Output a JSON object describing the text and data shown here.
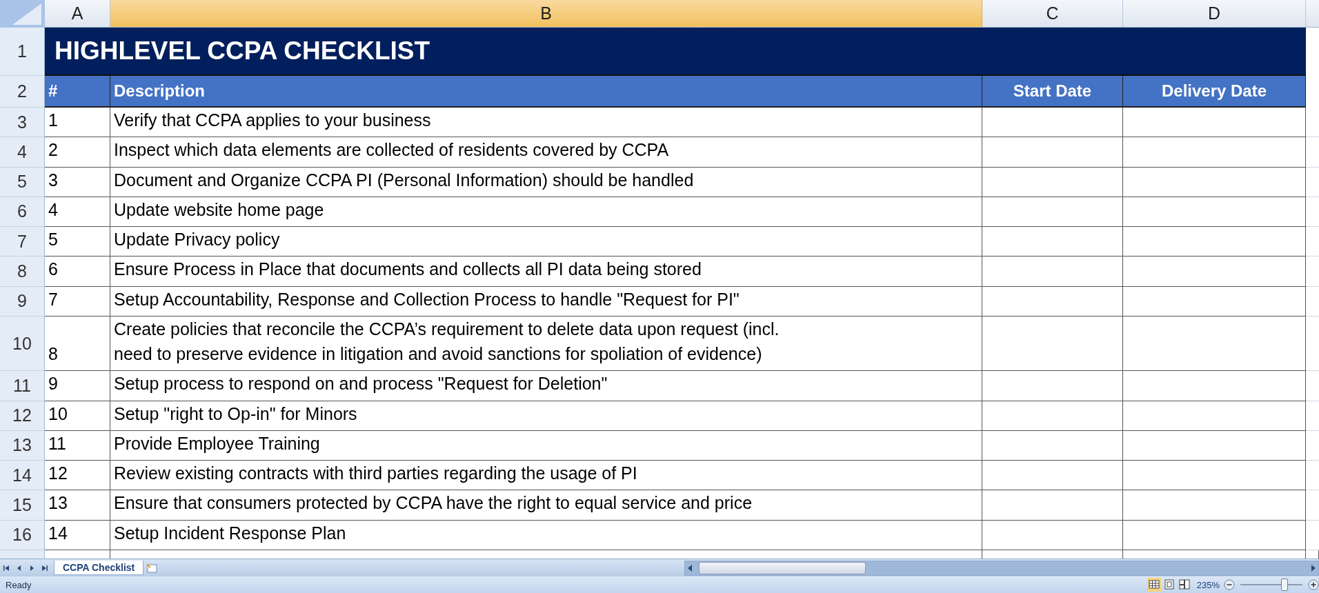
{
  "column_headers": [
    {
      "label": "A",
      "selected": false
    },
    {
      "label": "B",
      "selected": true
    },
    {
      "label": "C",
      "selected": false
    },
    {
      "label": "D",
      "selected": false
    }
  ],
  "title_row": {
    "row": "1",
    "text": "HIGHLEVEL CCPA CHECKLIST"
  },
  "header_row": {
    "row": "2",
    "cells": [
      "#",
      "Description",
      "Start Date",
      "Delivery Date"
    ]
  },
  "rows": [
    {
      "row": "3",
      "number": "1",
      "description": "Verify that CCPA applies to your business"
    },
    {
      "row": "4",
      "number": "2",
      "description": "Inspect which data elements are collected of residents covered by CCPA"
    },
    {
      "row": "5",
      "number": "3",
      "description": "Document and Organize CCPA PI (Personal Information) should be handled"
    },
    {
      "row": "6",
      "number": "4",
      "description": "Update website home page"
    },
    {
      "row": "7",
      "number": "5",
      "description": "Update Privacy policy"
    },
    {
      "row": "8",
      "number": "6",
      "description": "Ensure Process in Place that documents and collects all PI data being stored"
    },
    {
      "row": "9",
      "number": "7",
      "description": "Setup Accountability, Response and Collection Process to handle \"Request for PI\""
    },
    {
      "row": "10",
      "number": "8",
      "description": "Create policies that reconcile the CCPA’s requirement to delete data upon request (incl.\nneed to preserve evidence in litigation and avoid sanctions for spoliation of evidence)"
    },
    {
      "row": "11",
      "number": "9",
      "description": "Setup process to respond on and process \"Request for Deletion\""
    },
    {
      "row": "12",
      "number": "10",
      "description": "Setup \"right to Op-in\" for Minors"
    },
    {
      "row": "13",
      "number": "11",
      "description": "Provide Employee Training"
    },
    {
      "row": "14",
      "number": "12",
      "description": "Review existing contracts with third parties regarding the usage of PI"
    },
    {
      "row": "15",
      "number": "13",
      "description": "Ensure that consumers protected by CCPA have the right to equal service and price"
    },
    {
      "row": "16",
      "number": "14",
      "description": "Setup Incident Response Plan"
    }
  ],
  "sheet_tabs": [
    {
      "label": "CCPA Checklist",
      "selected": true
    }
  ],
  "status_bar": {
    "status": "Ready",
    "views": [
      {
        "kind": "normal",
        "selected": true
      },
      {
        "kind": "page-layout",
        "selected": false
      },
      {
        "kind": "page-break",
        "selected": false
      }
    ],
    "zoom": "235%",
    "level": 0.7
  }
}
